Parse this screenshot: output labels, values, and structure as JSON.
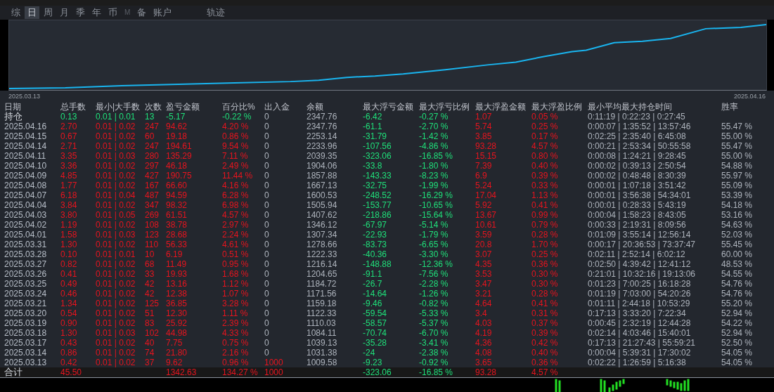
{
  "tabs": [
    {
      "label": "综",
      "selected": false,
      "dim": false
    },
    {
      "label": "日",
      "selected": true,
      "dim": false
    },
    {
      "label": "周",
      "selected": false,
      "dim": false
    },
    {
      "label": "月",
      "selected": false,
      "dim": false
    },
    {
      "label": "季",
      "selected": false,
      "dim": false
    },
    {
      "label": "年",
      "selected": false,
      "dim": false
    },
    {
      "label": "币",
      "selected": false,
      "dim": false
    },
    {
      "label": "M",
      "selected": false,
      "dim": true
    },
    {
      "label": "备",
      "selected": false,
      "dim": false
    },
    {
      "label": "账户",
      "selected": false,
      "dim": false
    },
    {
      "label": "轨迹",
      "selected": false,
      "dim": false
    }
  ],
  "chart": {
    "start_label": "2025.03.13",
    "end_label": "2025.04.16"
  },
  "table": {
    "columns": [
      "日期",
      "总手数",
      "最小|大手数",
      "次数",
      "盈亏金额",
      "百分比%",
      "出入金",
      "余额",
      "最大浮亏金额",
      "最大浮亏比例",
      "最大浮盈金额",
      "最大浮盈比例",
      "最小平均最大持仓时间",
      "胜率"
    ],
    "rows": [
      {
        "kind": "open",
        "profit": false,
        "funded": false,
        "cells": [
          "持仓",
          "0.13",
          "0.01 | 0.01",
          "13",
          "-5.17",
          "-0.22 %",
          "0",
          "2347.76",
          "-6.42",
          "-0.27 %",
          "1.07",
          "0.05 %",
          "0:11:19 | 0:22:23 | 0:27:45",
          null
        ]
      },
      {
        "kind": "day",
        "profit": true,
        "funded": false,
        "cells": [
          "2025.04.16",
          "2.70",
          "0.01 | 0.02",
          "247",
          "94.62",
          "4.20 %",
          "0",
          "2347.76",
          "-61.1",
          "-2.70 %",
          "5.74",
          "0.25 %",
          "0:00:07 | 1:35:52 | 13:57:46",
          "55.47 %"
        ]
      },
      {
        "kind": "day",
        "profit": true,
        "funded": false,
        "cells": [
          "2025.04.15",
          "0.67",
          "0.01 | 0.02",
          "60",
          "19.18",
          "0.86 %",
          "0",
          "2253.14",
          "-31.79",
          "-1.42 %",
          "3.85",
          "0.17 %",
          "0:02:25 | 2:35:40 | 6:45:08",
          "55.00 %"
        ]
      },
      {
        "kind": "day",
        "profit": true,
        "funded": false,
        "cells": [
          "2025.04.14",
          "2.71",
          "0.01 | 0.02",
          "247",
          "194.61",
          "9.54 %",
          "0",
          "2233.96",
          "-107.56",
          "-4.86 %",
          "93.28",
          "4.57 %",
          "0:00:21 | 2:53:34 | 50:55:58",
          "55.47 %"
        ]
      },
      {
        "kind": "day",
        "profit": true,
        "funded": false,
        "cells": [
          "2025.04.11",
          "3.35",
          "0.01 | 0.03",
          "280",
          "135.29",
          "7.11 %",
          "0",
          "2039.35",
          "-323.06",
          "-16.85 %",
          "15.15",
          "0.80 %",
          "0:00:08 | 1:24:21 | 9:28:45",
          "55.00 %"
        ]
      },
      {
        "kind": "day",
        "profit": true,
        "funded": false,
        "cells": [
          "2025.04.10",
          "3.36",
          "0.01 | 0.02",
          "297",
          "46.18",
          "2.49 %",
          "0",
          "1904.06",
          "-33.8",
          "-1.80 %",
          "7.39",
          "0.40 %",
          "0:00:02 | 0:39:13 | 2:50:54",
          "54.88 %"
        ]
      },
      {
        "kind": "day",
        "profit": true,
        "funded": false,
        "cells": [
          "2025.04.09",
          "4.85",
          "0.01 | 0.02",
          "427",
          "190.75",
          "11.44 %",
          "0",
          "1857.88",
          "-143.33",
          "-8.23 %",
          "6.9",
          "0.39 %",
          "0:00:02 | 0:48:48 | 8:30:39",
          "55.97 %"
        ]
      },
      {
        "kind": "day",
        "profit": true,
        "funded": false,
        "cells": [
          "2025.04.08",
          "1.77",
          "0.01 | 0.02",
          "167",
          "66.60",
          "4.16 %",
          "0",
          "1667.13",
          "-32.75",
          "-1.99 %",
          "5.24",
          "0.33 %",
          "0:00:01 | 1:07:18 | 3:51:42",
          "55.09 %"
        ]
      },
      {
        "kind": "day",
        "profit": true,
        "funded": false,
        "cells": [
          "2025.04.07",
          "6.18",
          "0.01 | 0.04",
          "487",
          "94.59",
          "6.28 %",
          "0",
          "1600.53",
          "-248.52",
          "-16.29 %",
          "17.04",
          "1.13 %",
          "0:00:01 | 3:56:38 | 54:34:01",
          "53.39 %"
        ]
      },
      {
        "kind": "day",
        "profit": true,
        "funded": false,
        "cells": [
          "2025.04.04",
          "3.84",
          "0.01 | 0.02",
          "347",
          "98.32",
          "6.98 %",
          "0",
          "1505.94",
          "-153.77",
          "-10.65 %",
          "5.92",
          "0.41 %",
          "0:00:01 | 0:28:33 | 5:43:19",
          "54.18 %"
        ]
      },
      {
        "kind": "day",
        "profit": true,
        "funded": false,
        "cells": [
          "2025.04.03",
          "3.80",
          "0.01 | 0.05",
          "269",
          "61.51",
          "4.57 %",
          "0",
          "1407.62",
          "-218.86",
          "-15.64 %",
          "13.67",
          "0.99 %",
          "0:00:04 | 1:58:23 | 8:43:05",
          "53.16 %"
        ]
      },
      {
        "kind": "day",
        "profit": true,
        "funded": false,
        "cells": [
          "2025.04.02",
          "1.19",
          "0.01 | 0.02",
          "108",
          "38.78",
          "2.97 %",
          "0",
          "1346.12",
          "-67.97",
          "-5.14 %",
          "10.61",
          "0.79 %",
          "0:00:33 | 2:19:31 | 8:09:56",
          "54.63 %"
        ]
      },
      {
        "kind": "day",
        "profit": true,
        "funded": false,
        "cells": [
          "2025.04.01",
          "1.58",
          "0.01 | 0.03",
          "123",
          "28.68",
          "2.24 %",
          "0",
          "1307.34",
          "-22.93",
          "-1.79 %",
          "3.59",
          "0.28 %",
          "0:01:09 | 3:55:14 | 12:56:14",
          "52.03 %"
        ]
      },
      {
        "kind": "day",
        "profit": true,
        "funded": false,
        "cells": [
          "2025.03.31",
          "1.30",
          "0.01 | 0.02",
          "110",
          "56.33",
          "4.61 %",
          "0",
          "1278.66",
          "-83.73",
          "-6.65 %",
          "20.8",
          "1.70 %",
          "0:00:17 | 20:36:53 | 73:37:47",
          "55.45 %"
        ]
      },
      {
        "kind": "day",
        "profit": true,
        "funded": false,
        "cells": [
          "2025.03.28",
          "0.10",
          "0.01 | 0.01",
          "10",
          "6.19",
          "0.51 %",
          "0",
          "1222.33",
          "-40.36",
          "-3.30 %",
          "3.07",
          "0.25 %",
          "0:02:11 | 2:52:14 | 6:02:12",
          "60.00 %"
        ]
      },
      {
        "kind": "day",
        "profit": true,
        "funded": false,
        "cells": [
          "2025.03.27",
          "0.82",
          "0.01 | 0.02",
          "68",
          "11.49",
          "0.95 %",
          "0",
          "1216.14",
          "-148.88",
          "-12.36 %",
          "4.35",
          "0.36 %",
          "0:02:50 | 4:39:42 | 12:41:12",
          "48.53 %"
        ]
      },
      {
        "kind": "day",
        "profit": true,
        "funded": false,
        "cells": [
          "2025.03.26",
          "0.41",
          "0.01 | 0.02",
          "33",
          "19.93",
          "1.68 %",
          "0",
          "1204.65",
          "-91.1",
          "-7.56 %",
          "3.53",
          "0.30 %",
          "0:21:01 | 10:32:16 | 19:13:06",
          "54.55 %"
        ]
      },
      {
        "kind": "day",
        "profit": true,
        "funded": false,
        "cells": [
          "2025.03.25",
          "0.49",
          "0.01 | 0.02",
          "42",
          "13.16",
          "1.12 %",
          "0",
          "1184.72",
          "-26.7",
          "-2.28 %",
          "3.47",
          "0.30 %",
          "0:01:23 | 7:00:25 | 16:18:28",
          "54.76 %"
        ]
      },
      {
        "kind": "day",
        "profit": true,
        "funded": false,
        "cells": [
          "2025.03.24",
          "0.46",
          "0.01 | 0.02",
          "42",
          "12.38",
          "1.07 %",
          "0",
          "1171.56",
          "-14.64",
          "-1.26 %",
          "3.21",
          "0.28 %",
          "0:01:19 | 7:03:00 | 54:20:26",
          "54.76 %"
        ]
      },
      {
        "kind": "day",
        "profit": true,
        "funded": false,
        "cells": [
          "2025.03.21",
          "1.34",
          "0.01 | 0.02",
          "125",
          "36.85",
          "3.28 %",
          "0",
          "1159.18",
          "-9.46",
          "-0.82 %",
          "4.64",
          "0.41 %",
          "0:01:11 | 2:44:18 | 10:53:29",
          "55.20 %"
        ]
      },
      {
        "kind": "day",
        "profit": true,
        "funded": false,
        "cells": [
          "2025.03.20",
          "0.54",
          "0.01 | 0.02",
          "51",
          "12.30",
          "1.11 %",
          "0",
          "1122.33",
          "-59.54",
          "-5.33 %",
          "3.4",
          "0.31 %",
          "0:17:13 | 3:33:20 | 7:22:34",
          "52.94 %"
        ]
      },
      {
        "kind": "day",
        "profit": true,
        "funded": false,
        "cells": [
          "2025.03.19",
          "0.90",
          "0.01 | 0.02",
          "83",
          "25.92",
          "2.39 %",
          "0",
          "1110.03",
          "-58.57",
          "-5.37 %",
          "4.03",
          "0.37 %",
          "0:00:45 | 2:32:19 | 12:44:28",
          "54.22 %"
        ]
      },
      {
        "kind": "day",
        "profit": true,
        "funded": false,
        "cells": [
          "2025.03.18",
          "1.30",
          "0.01 | 0.03",
          "102",
          "44.98",
          "4.33 %",
          "0",
          "1084.11",
          "-70.74",
          "-6.70 %",
          "4.19",
          "0.39 %",
          "0:02:14 | 4:03:46 | 15:40:01",
          "52.94 %"
        ]
      },
      {
        "kind": "day",
        "profit": true,
        "funded": false,
        "cells": [
          "2025.03.17",
          "0.43",
          "0.01 | 0.02",
          "40",
          "7.75",
          "0.75 %",
          "0",
          "1039.13",
          "-35.28",
          "-3.41 %",
          "4.36",
          "0.42 %",
          "0:17:13 | 21:27:43 | 55:59:21",
          "52.50 %"
        ]
      },
      {
        "kind": "day",
        "profit": true,
        "funded": false,
        "cells": [
          "2025.03.14",
          "0.86",
          "0.01 | 0.02",
          "74",
          "21.80",
          "2.16 %",
          "0",
          "1031.38",
          "-24",
          "-2.38 %",
          "4.08",
          "0.40 %",
          "0:00:04 | 5:39:31 | 17:30:02",
          "54.05 %"
        ]
      },
      {
        "kind": "day",
        "profit": true,
        "funded": true,
        "cells": [
          "2025.03.13",
          "0.42",
          "0.01 | 0.02",
          "37",
          "9.62",
          "0.96 %",
          "1000",
          "1009.58",
          "-9.23",
          "-0.92 %",
          "3.65",
          "0.36 %",
          "0:02:22 | 1:26:59 | 5:16:38",
          "54.05 %"
        ]
      },
      {
        "kind": "total",
        "profit": true,
        "funded": true,
        "cells": [
          "合计",
          "45.50",
          null,
          null,
          "1342.63",
          "134.27 %",
          "1000",
          null,
          "-323.06",
          "-16.85 %",
          "93.28",
          "4.57 %",
          null,
          null
        ]
      }
    ]
  }
}
